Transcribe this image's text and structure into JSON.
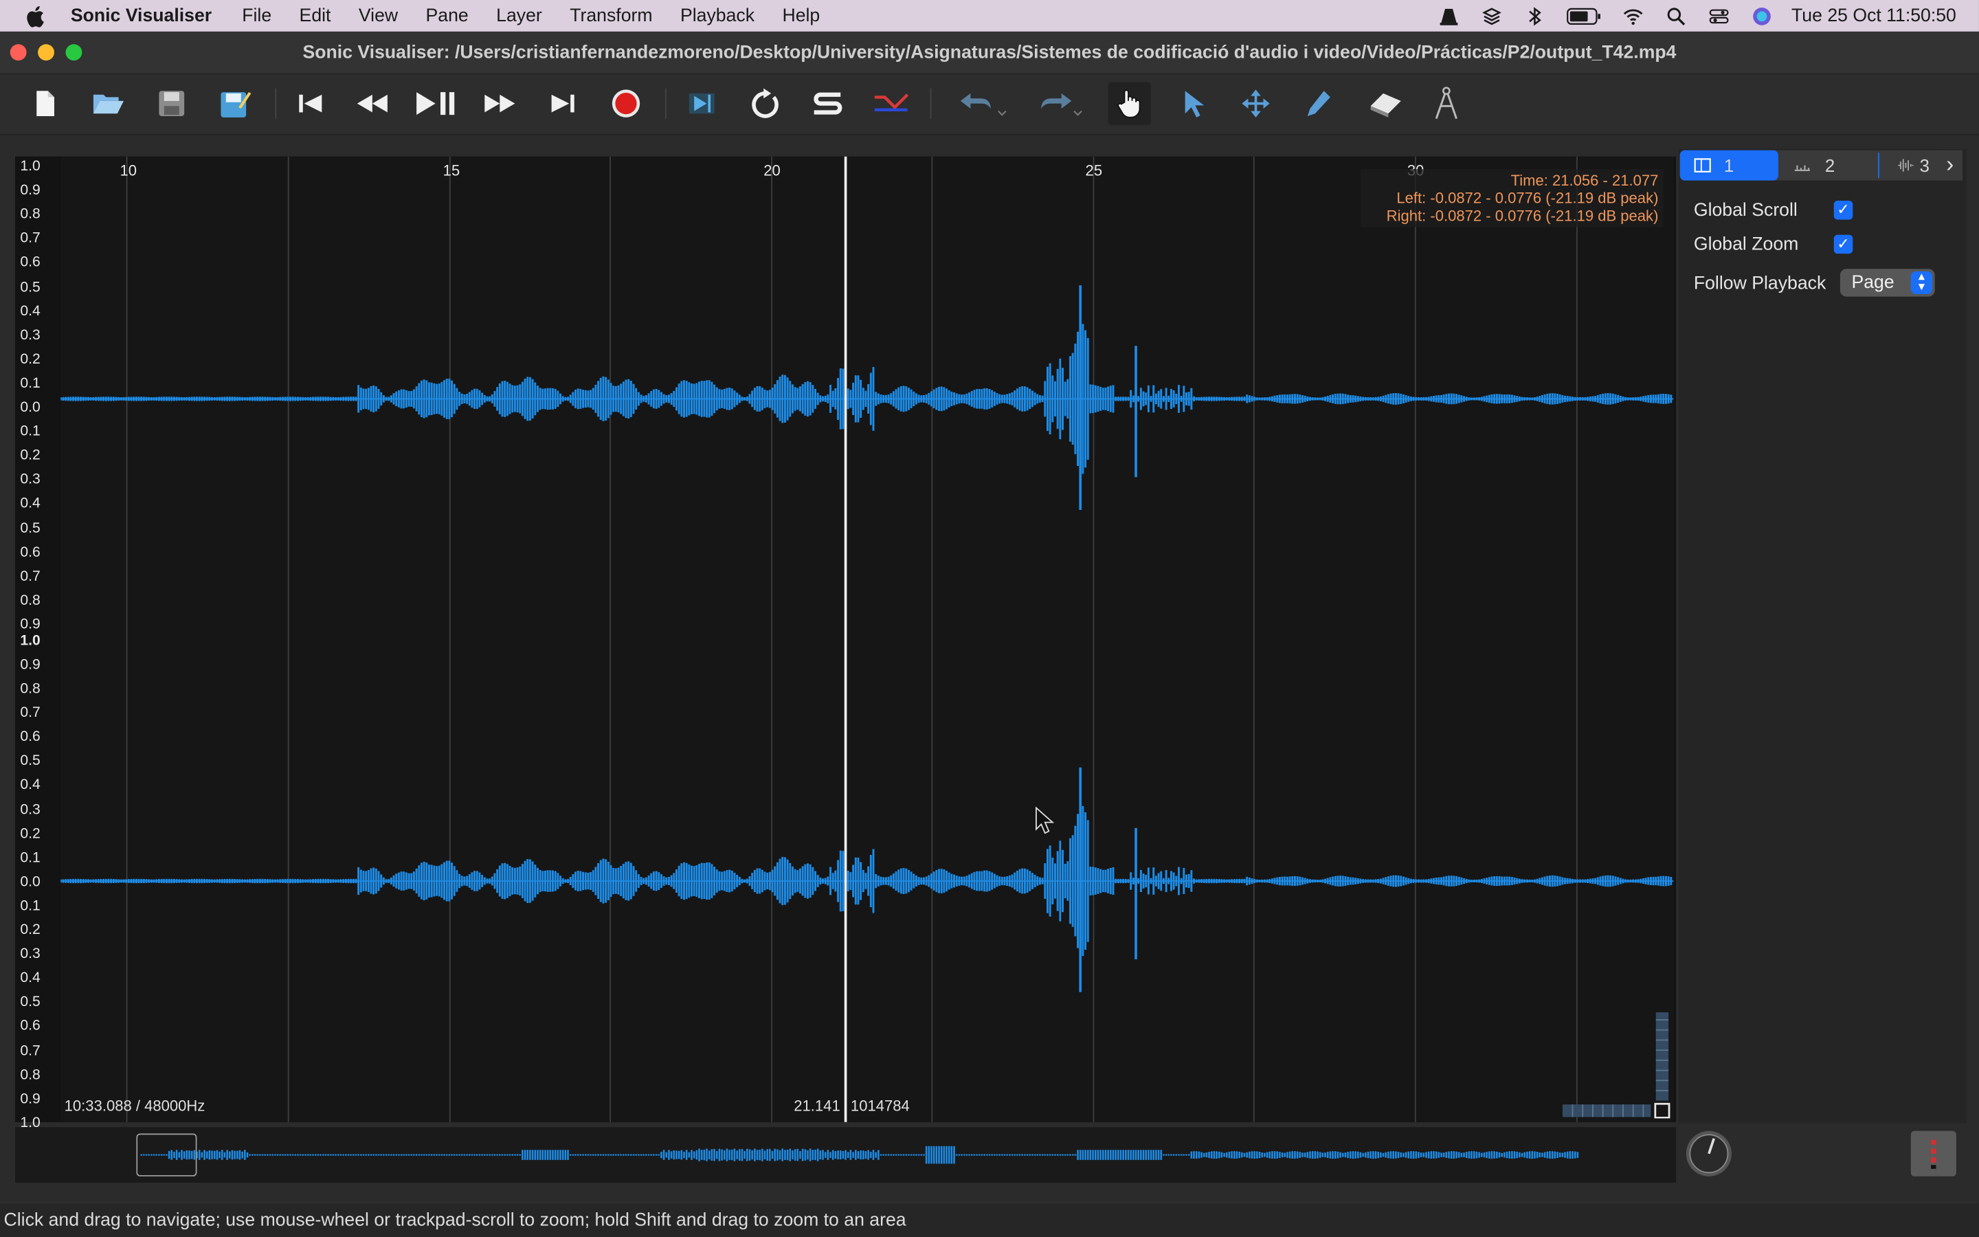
{
  "menubar": {
    "app_name": "Sonic Visualiser",
    "items": [
      "File",
      "Edit",
      "View",
      "Pane",
      "Layer",
      "Transform",
      "Playback",
      "Help"
    ],
    "clock": "Tue 25 Oct  11:50:50"
  },
  "window": {
    "title": "Sonic Visualiser: /Users/cristianfernandezmoreno/Desktop/University/Asignaturas/Sistemes de codificació d'audio i video/Video/Prácticas/P2/output_T42.mp4"
  },
  "toolbar": {
    "icons": [
      "new-file-icon",
      "open-file-icon",
      "save-icon",
      "save-as-icon",
      "rewind-start-icon",
      "rewind-icon",
      "play-pause-icon",
      "fast-forward-icon",
      "fast-forward-end-icon",
      "record-icon",
      "play-selection-icon",
      "loop-icon",
      "solo-icon",
      "align-icon",
      "undo-icon",
      "redo-icon",
      "navigate-tool-icon",
      "select-tool-icon",
      "move-tool-icon",
      "draw-tool-icon",
      "erase-tool-icon",
      "measure-tool-icon"
    ]
  },
  "pane": {
    "time_ticks": [
      "10",
      "15",
      "20",
      "25",
      "30"
    ],
    "amp_ticks_top": [
      "1.0",
      "0.9",
      "0.8",
      "0.7",
      "0.6",
      "0.5",
      "0.4",
      "0.3",
      "0.2",
      "0.1",
      "0.0",
      "0.1",
      "0.2",
      "0.3",
      "0.4",
      "0.5",
      "0.6",
      "0.7",
      "0.8",
      "0.9"
    ],
    "amp_mid": "1.0",
    "amp_ticks_bottom": [
      "0.9",
      "0.8",
      "0.7",
      "0.6",
      "0.5",
      "0.4",
      "0.3",
      "0.2",
      "0.1",
      "0.0",
      "0.1",
      "0.2",
      "0.3",
      "0.4",
      "0.5",
      "0.6",
      "0.7",
      "0.8",
      "0.9",
      "1.0"
    ],
    "info_time": "Time: 21.056 - 21.077",
    "info_left": "Left: -0.0872 - 0.0776 (-21.19 dB peak)",
    "info_right": "Right: -0.0872 - 0.0776 (-21.19 dB peak)",
    "duration_rate": "10:33.088 / 48000Hz",
    "playhead_time": "21.141",
    "playhead_frame": "1014784",
    "waveform_color": "#1e8ce6"
  },
  "properties": {
    "tabs": [
      "1",
      "2",
      "3"
    ],
    "global_scroll_label": "Global Scroll",
    "global_scroll": true,
    "global_zoom_label": "Global Zoom",
    "global_zoom": true,
    "follow_playback_label": "Follow Playback",
    "follow_playback_value": "Page"
  },
  "status_bar": {
    "text": "Click and drag to navigate; use mouse-wheel or trackpad-scroll to zoom; hold Shift and drag to zoom to an area"
  }
}
